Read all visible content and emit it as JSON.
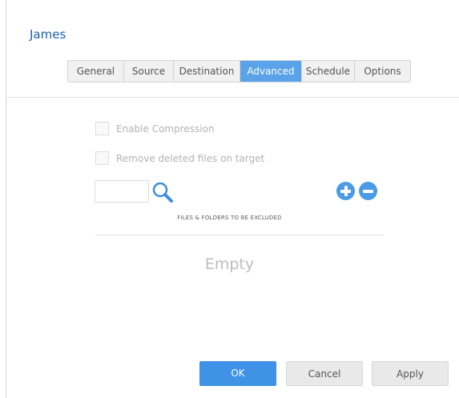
{
  "dialog": {
    "title": "James"
  },
  "tabs": [
    {
      "label": "General"
    },
    {
      "label": "Source"
    },
    {
      "label": "Destination"
    },
    {
      "label": "Advanced",
      "active": true
    },
    {
      "label": "Schedule"
    },
    {
      "label": "Options"
    }
  ],
  "options": {
    "enable_compression": {
      "label": "Enable Compression",
      "checked": false,
      "disabled": true
    },
    "remove_deleted": {
      "label": "Remove deleted files on target",
      "checked": false,
      "disabled": true
    }
  },
  "exclusions": {
    "filter_value": "",
    "header": "FILES & FOLDERS TO BE EXCLUDED",
    "empty_text": "Empty",
    "icons": [
      "search-icon",
      "add-icon",
      "remove-icon"
    ]
  },
  "footer": {
    "ok_label": "OK",
    "cancel_label": "Cancel",
    "apply_label": "Apply"
  },
  "colors": {
    "accent": "#3f92e6",
    "active_tab": "#5aa3e8",
    "title": "#1f5fae"
  }
}
